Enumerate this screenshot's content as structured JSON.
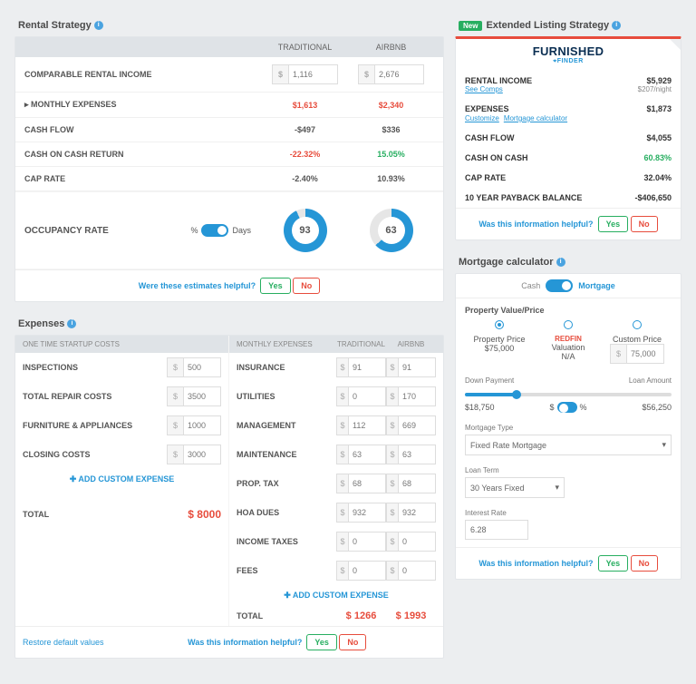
{
  "rentalStrategy": {
    "title": "Rental Strategy",
    "header": {
      "col1": "TRADITIONAL",
      "col2": "AIRBNB"
    },
    "rows": {
      "income": {
        "label": "COMPARABLE RENTAL INCOME",
        "trad": "1,116",
        "airbnb": "2,676"
      },
      "monthly": {
        "label": "▸ MONTHLY EXPENSES",
        "trad": "$1,613",
        "airbnb": "$2,340"
      },
      "cashflow": {
        "label": "CASH FLOW",
        "trad": "-$497",
        "airbnb": "$336"
      },
      "coc": {
        "label": "CASH ON CASH RETURN",
        "trad": "-22.32%",
        "airbnb": "15.05%"
      },
      "cap": {
        "label": "CAP RATE",
        "trad": "-2.40%",
        "airbnb": "10.93%"
      }
    },
    "occupancy": {
      "label": "OCCUPANCY RATE",
      "unitLeft": "%",
      "unitRight": "Days",
      "trad": "93",
      "airbnb": "63"
    },
    "prompt": {
      "q": "Were these estimates helpful?",
      "yes": "Yes",
      "no": "No"
    }
  },
  "extended": {
    "tag": "New",
    "title": "Extended Listing Strategy",
    "brand": "FURNISHED",
    "brandSub": "FINDER",
    "rows": {
      "income": {
        "label": "RENTAL INCOME",
        "val": "$5,929",
        "sub": "$207/night",
        "link": "See Comps"
      },
      "exp": {
        "label": "EXPENSES",
        "val": "$1,873",
        "link1": "Customize",
        "link2": "Mortgage calculator"
      },
      "cf": {
        "label": "CASH FLOW",
        "val": "$4,055"
      },
      "coc": {
        "label": "CASH ON CASH",
        "val": "60.83%"
      },
      "cap": {
        "label": "CAP RATE",
        "val": "32.04%"
      },
      "pb": {
        "label": "10 YEAR PAYBACK BALANCE",
        "val": "-$406,650"
      }
    },
    "prompt": {
      "q": "Was this information helpful?",
      "yes": "Yes",
      "no": "No"
    }
  },
  "expenses": {
    "title": "Expenses",
    "startup": {
      "header": "ONE TIME STARTUP COSTS",
      "items": [
        {
          "label": "INSPECTIONS",
          "val": "500"
        },
        {
          "label": "TOTAL REPAIR COSTS",
          "val": "3500"
        },
        {
          "label": "FURNITURE & APPLIANCES",
          "val": "1000"
        },
        {
          "label": "CLOSING COSTS",
          "val": "3000"
        }
      ],
      "add": "ADD CUSTOM EXPENSE",
      "totalLabel": "TOTAL",
      "total": "$ 8000"
    },
    "monthly": {
      "header": "MONTHLY EXPENSES",
      "h2": "TRADITIONAL",
      "h3": "AIRBNB",
      "items": [
        {
          "label": "INSURANCE",
          "t": "91",
          "a": "91"
        },
        {
          "label": "UTILITIES",
          "t": "0",
          "a": "170"
        },
        {
          "label": "MANAGEMENT",
          "t": "112",
          "a": "669"
        },
        {
          "label": "MAINTENANCE",
          "t": "63",
          "a": "63"
        },
        {
          "label": "PROP. TAX",
          "t": "68",
          "a": "68"
        },
        {
          "label": "HOA DUES",
          "t": "932",
          "a": "932"
        },
        {
          "label": "INCOME TAXES",
          "t": "0",
          "a": "0"
        },
        {
          "label": "FEES",
          "t": "0",
          "a": "0"
        }
      ],
      "add": "ADD CUSTOM EXPENSE",
      "totalLabel": "TOTAL",
      "tTotal": "$ 1266",
      "aTotal": "$ 1993"
    },
    "restore": "Restore default values",
    "prompt": {
      "q": "Was this information helpful?",
      "yes": "Yes",
      "no": "No"
    }
  },
  "mortgage": {
    "title": "Mortgage calculator",
    "modeL": "Cash",
    "modeR": "Mortgage",
    "priceHeader": "Property Value/Price",
    "opts": [
      {
        "l1": "Property Price",
        "l2": "$75,000"
      },
      {
        "l1": "REDFIN",
        "l2": "Valuation",
        "l3": "N/A"
      },
      {
        "l1": "Custom Price",
        "l2": "75,000"
      }
    ],
    "down": {
      "label": "Down Payment",
      "amt": "$18,750",
      "pct": "$",
      "pctR": "%"
    },
    "loan": {
      "label": "Loan Amount",
      "amt": "$56,250"
    },
    "type": {
      "label": "Mortgage Type",
      "val": "Fixed Rate Mortgage"
    },
    "term": {
      "label": "Loan Term",
      "val": "30 Years Fixed"
    },
    "rate": {
      "label": "Interest Rate",
      "val": "6.28"
    },
    "prompt": {
      "q": "Was this information helpful?",
      "yes": "Yes",
      "no": "No"
    }
  }
}
